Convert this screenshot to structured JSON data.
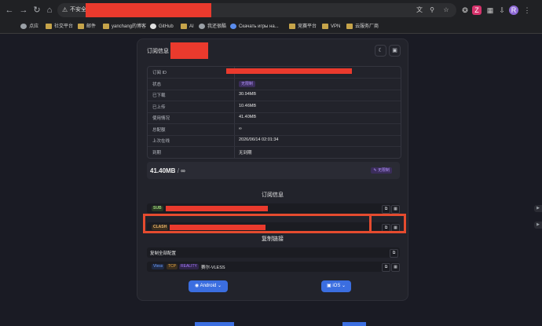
{
  "browser": {
    "back_icon": "arrow-left-icon",
    "forward_icon": "arrow-right-icon",
    "reload_icon": "reload-icon",
    "home_icon": "home-icon",
    "security_label": "不安全",
    "url_redacted": true,
    "profile_initial": "R",
    "bookmarks": [
      "点应",
      "社交平台",
      "邮件",
      "yanchang的博客",
      "GitHub",
      "AI",
      "我还很酷",
      "Скачать игры на...",
      "竞赛平台",
      "VPN",
      "云服务厂商"
    ]
  },
  "card": {
    "title": "订阅信息",
    "title_redacted": true,
    "theme_icon": "moon-icon",
    "qr_icon": "image-icon"
  },
  "info_table": {
    "rows": [
      {
        "label": "订阅 ID",
        "value": ""
      },
      {
        "label": "状态",
        "value": "无限制",
        "badge": true
      },
      {
        "label": "已下载",
        "value": "30.94MB"
      },
      {
        "label": "已上传",
        "value": "10.46MB"
      },
      {
        "label": "使用情况",
        "value": "41.40MB"
      },
      {
        "label": "总配额",
        "value": "∞"
      },
      {
        "label": "上次在线",
        "value": "2026/06/14 02:01:34"
      },
      {
        "label": "到期",
        "value": "无到期"
      }
    ]
  },
  "summary": {
    "usage": "41.40MB",
    "separator": "/",
    "quota": "∞",
    "badge": "无限制"
  },
  "subscription": {
    "section_title": "订阅信息",
    "sub_tag": "SUB",
    "clash_tag": "CLASH"
  },
  "links": {
    "section_title": "复制链接",
    "copy_all_label": "复制全部配置",
    "node": {
      "protocol": "Vless",
      "transport": "TCP",
      "security": "REALITY",
      "name": "赛尔-VLESS"
    }
  },
  "apps": {
    "android_label": "Android",
    "ios_label": "iOS"
  },
  "colors": {
    "background": "#1a1b24",
    "card": "#22232b",
    "accent": "#3b6ee0",
    "redaction": "#ea3a2d",
    "highlight": "#e54b2f"
  }
}
